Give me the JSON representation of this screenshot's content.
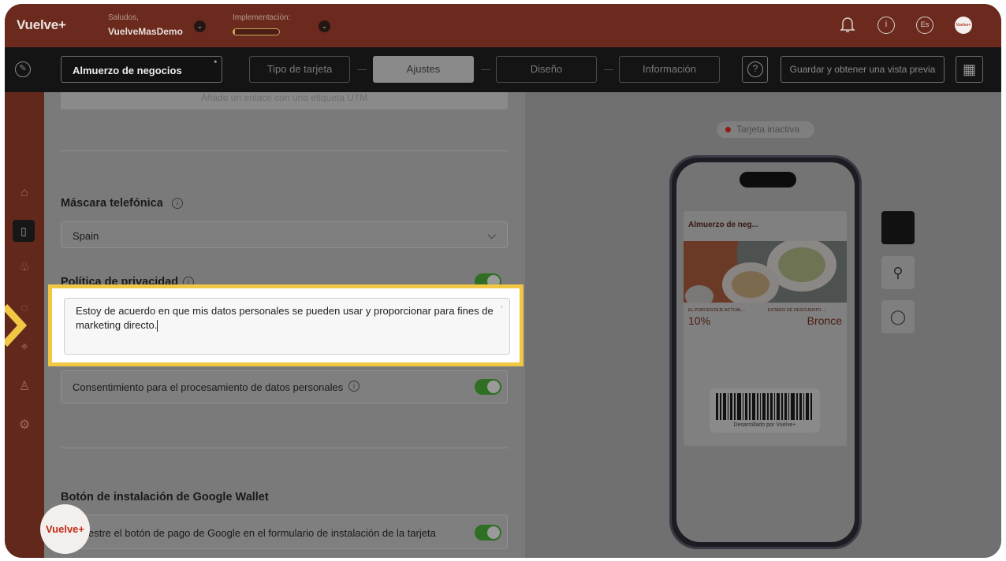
{
  "header": {
    "logo": "Vuelve+",
    "greeting_label": "Saludos,",
    "greeting_user": "VuelveMasDemo",
    "implementation_label": "Implementación:",
    "implementation_progress": 0.03,
    "lang": "Es",
    "avatar_text": "Vuelve+",
    "icons": [
      "bell-icon",
      "info-icon",
      "language-icon",
      "avatar"
    ]
  },
  "toolbar": {
    "card_name": "Almuerzo de negocios",
    "required_mark": "*",
    "steps": [
      "Tipo de tarjeta",
      "Ajustes",
      "Diseño",
      "Información"
    ],
    "active_step": "Ajustes",
    "help": "?",
    "preview_label": "Guardar y obtener una vista previa"
  },
  "sidebar": {
    "items": [
      "home-icon",
      "card-icon",
      "users-icon",
      "chat-icon",
      "location-icon",
      "user-icon",
      "gear-icon"
    ],
    "active": "card-icon"
  },
  "settings": {
    "utm_hint": "Añade un enlace con una etiqueta UTM",
    "phone_mask_title": "Máscara telefónica",
    "phone_mask_value": "Spain",
    "privacy_title": "Política de privacidad",
    "privacy_enabled": true,
    "privacy_text": "Estoy de acuerdo en que mis datos personales se pueden usar y proporcionar para fines de marketing directo.",
    "consent_label": "Consentimiento para el procesamiento de datos personales",
    "consent_enabled": true,
    "gwallet_title": "Botón de instalación de Google Wallet",
    "gwallet_label": "estre el botón de pago de Google en el formulario de instalación de la tarjeta",
    "gwallet_enabled": true
  },
  "preview": {
    "status": "Tarjeta inactiva",
    "status_color": "#8e1c12",
    "card_title": "Almuerzo de neg...",
    "field1_label": "EL PORCENTAJE ACTUAL...",
    "field1_value": "10%",
    "field2_label": "ESTADO DE DESCUENTO ...",
    "field2_value": "Bronce",
    "footer": "Desarrollado por Vuelve+",
    "platforms": [
      "apple-icon",
      "android-icon",
      "chat-icon"
    ],
    "active_platform": "apple-icon"
  },
  "colors": {
    "brand": "#6b2a1d",
    "highlight": "#f2c744",
    "toggle_on": "#2f6f23"
  }
}
